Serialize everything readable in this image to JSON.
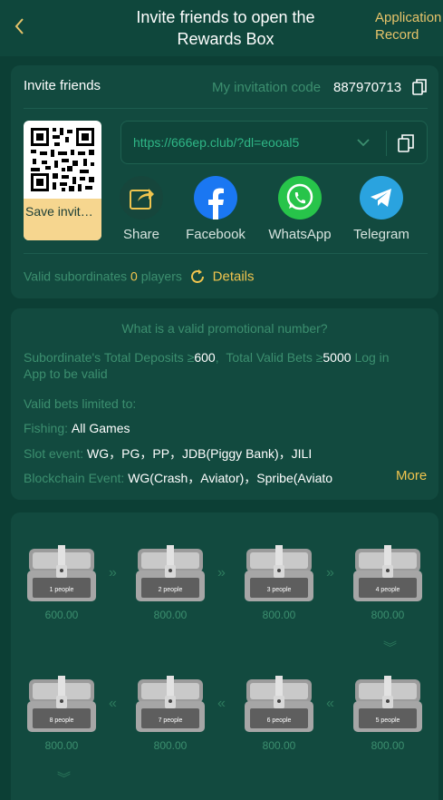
{
  "header": {
    "title": "Invite friends to open the Rewards Box",
    "record_link": "Application Record"
  },
  "invite": {
    "title": "Invite friends",
    "code_label": "My invitation code",
    "code_value": "887970713",
    "save_label": "Save invitation...",
    "url": "https://666ep.club/?dl=eooal5",
    "share": [
      {
        "label": "Share",
        "icon": "share-icon"
      },
      {
        "label": "Facebook",
        "icon": "facebook-icon"
      },
      {
        "label": "WhatsApp",
        "icon": "whatsapp-icon"
      },
      {
        "label": "Telegram",
        "icon": "telegram-icon"
      }
    ],
    "valid_label": "Valid subordinates",
    "valid_count": "0",
    "valid_unit": "players",
    "details_label": "Details"
  },
  "rules": {
    "question": "What is a valid promotional number?",
    "deposit_label": "Subordinate's Total Deposits ≥",
    "deposit_value": "600",
    "bets_label": "Total Valid Bets ≥",
    "bets_value": "5000",
    "login_note_1": "Log in",
    "login_note_2": "App to be valid",
    "limited_label": "Valid bets limited to:",
    "fishing_label": "Fishing:",
    "fishing_value": "All Games",
    "slot_label": "Slot event:",
    "slot_value": "WG，PG，PP，JDB(Piggy Bank)，JILI",
    "block_label": "Blockchain Event:",
    "block_value": "WG(Crash，Aviator)，Spribe(Aviato",
    "more_label": "More"
  },
  "chests": [
    {
      "label": "1 people",
      "amount": "600.00"
    },
    {
      "label": "2 people",
      "amount": "800.00"
    },
    {
      "label": "3 people",
      "amount": "800.00"
    },
    {
      "label": "4 people",
      "amount": "800.00"
    },
    {
      "label": "5 people",
      "amount": "800.00"
    },
    {
      "label": "6 people",
      "amount": "800.00"
    },
    {
      "label": "7 people",
      "amount": "800.00"
    },
    {
      "label": "8 people",
      "amount": "800.00"
    }
  ],
  "colors": {
    "background": "#0c3f35",
    "card": "#124a3f",
    "accent_gold": "#f0c44e",
    "muted_green": "#3c8f6f",
    "url_green": "#2fb686"
  }
}
